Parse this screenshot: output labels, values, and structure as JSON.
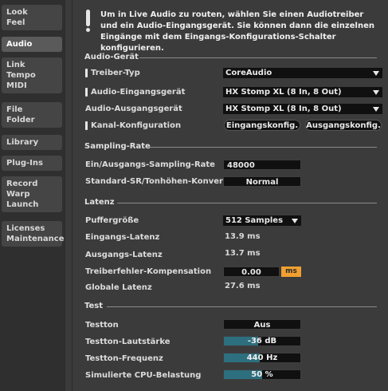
{
  "sidebar": {
    "tabs": [
      {
        "lines": [
          "Look",
          "Feel"
        ]
      },
      {
        "lines": [
          "Audio"
        ]
      },
      {
        "lines": [
          "Link",
          "Tempo",
          "MIDI"
        ]
      },
      {
        "lines": [
          "File",
          "Folder"
        ]
      },
      {
        "lines": [
          "Library"
        ]
      },
      {
        "lines": [
          "Plug-Ins"
        ]
      },
      {
        "lines": [
          "Record",
          "Warp",
          "Launch"
        ]
      },
      {
        "lines": [
          "Licenses",
          "Maintenance"
        ]
      }
    ]
  },
  "info": {
    "message": "Um in Live Audio zu routen, wählen Sie einen Audiotreiber und ein Audio-Eingangsgerät. Sie können dann die einzelnen Eingänge mit dem Eingangs-Konfigurations-Schalter konfigurieren."
  },
  "audio_device": {
    "section": "Audio-Gerät",
    "driver_type_label": "Treiber-Typ",
    "driver_type_value": "CoreAudio",
    "input_device_label": "Audio-Eingangsgerät",
    "input_device_value": "HX Stomp XL (8 In, 8 Out)",
    "output_device_label": "Audio-Ausgangsgerät",
    "output_device_value": "HX Stomp XL (8 In, 8 Out)",
    "channel_config_label": "Kanal-Konfiguration",
    "input_config_button": "Eingangskonfig.",
    "output_config_button": "Ausgangskonfig."
  },
  "sampling": {
    "section": "Sampling-Rate",
    "rate_label": "Ein/Ausgangs-Sampling-Rate",
    "rate_value": "48000",
    "conversion_label": "Standard-SR/Tonhöhen-Konvert.",
    "conversion_value": "Normal"
  },
  "latency": {
    "section": "Latenz",
    "buffer_label": "Puffergröße",
    "buffer_value": "512 Samples",
    "input_latency_label": "Eingangs-Latenz",
    "input_latency_value": "13.9 ms",
    "output_latency_label": "Ausgangs-Latenz",
    "output_latency_value": "13.7 ms",
    "compensation_label": "Treiberfehler-Kompensation",
    "compensation_value": "0.00",
    "compensation_unit": "ms",
    "global_label": "Globale Latenz",
    "global_value": "27.6 ms"
  },
  "test": {
    "section": "Test",
    "tone_label": "Testton",
    "tone_value": "Aus",
    "volume_label": "Testton-Lautstärke",
    "volume_value": "-36 dB",
    "volume_level": 0.45,
    "frequency_label": "Testton-Frequenz",
    "frequency_value": "440 Hz",
    "frequency_level": 0.47,
    "cpu_label": "Simulierte CPU-Belastung",
    "cpu_value": "50 %",
    "cpu_level": 0.5
  },
  "colors": {
    "accent_orange": "#f0a030",
    "bar_fill": "#2d6f7e",
    "panel_bg": "#3b3b3b"
  }
}
